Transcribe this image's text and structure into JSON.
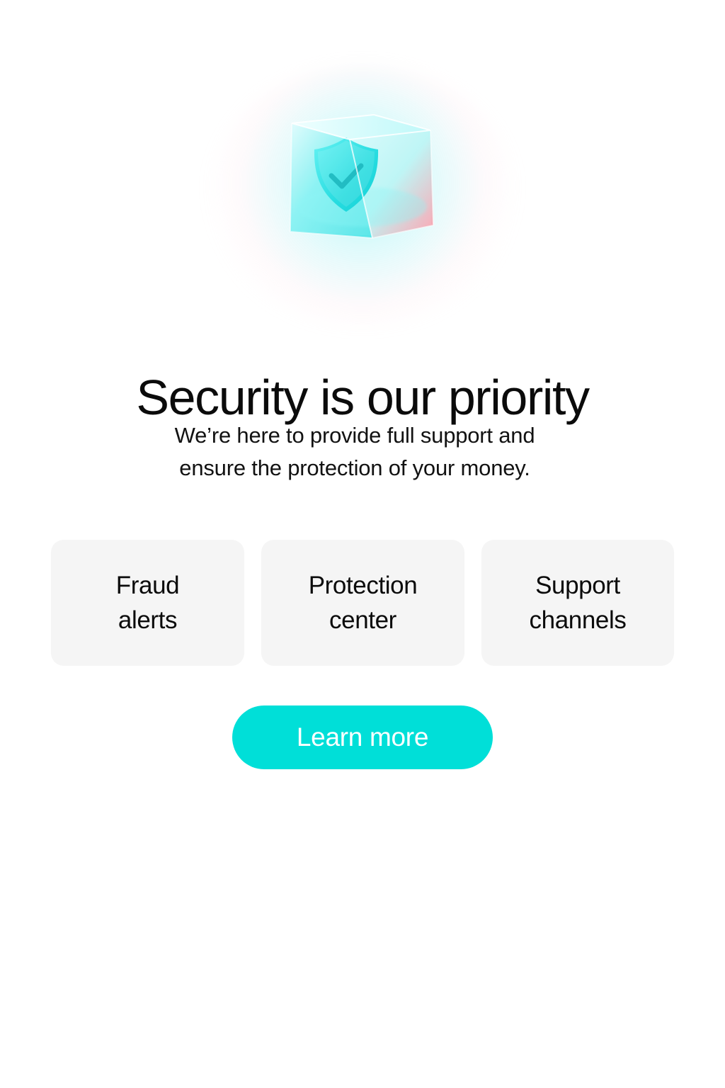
{
  "hero": {
    "icon_name": "shield-check-icon",
    "accent_color": "#00dfd8",
    "secondary_glow_color": "#ff9fb2"
  },
  "content": {
    "title": "Security is our priority",
    "subtitle_line_1": "We’re here to provide full support and",
    "subtitle_line_2": "ensure the protection of your money."
  },
  "cards": [
    {
      "label": "Fraud\nalerts"
    },
    {
      "label": "Protection\ncenter"
    },
    {
      "label": "Support\nchannels"
    }
  ],
  "cta": {
    "label": "Learn more",
    "background_color": "#00dfd8",
    "text_color": "#ffffff"
  }
}
